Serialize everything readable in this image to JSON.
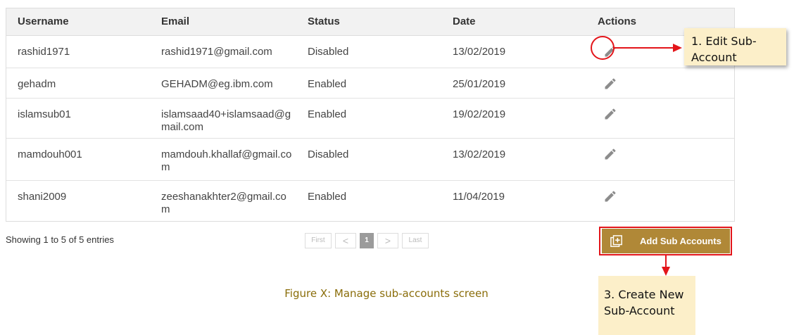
{
  "table": {
    "headers": [
      "Username",
      "Email",
      "Status",
      "Date",
      "Actions"
    ],
    "rows": [
      {
        "username": "rashid1971",
        "email": "rashid1971@gmail.com",
        "status": "Disabled",
        "date": "13/02/2019"
      },
      {
        "username": "gehadm",
        "email": "GEHADM@eg.ibm.com",
        "status": "Enabled",
        "date": "25/01/2019"
      },
      {
        "username": "islamsub01",
        "email": "islamsaad40+islamsaad@gmail.com",
        "status": "Enabled",
        "date": "19/02/2019"
      },
      {
        "username": "mamdouh001",
        "email": "mamdouh.khallaf@gmail.com",
        "status": "Disabled",
        "date": "13/02/2019"
      },
      {
        "username": "shani2009",
        "email": "zeeshanakhter2@gmail.com",
        "status": "Enabled",
        "date": "11/04/2019"
      }
    ],
    "action_icon": "pencil-icon"
  },
  "footer": {
    "showing": "Showing 1 to 5 of 5 entries",
    "pager": {
      "first": "First",
      "prev": "<",
      "current": "1",
      "next": ">",
      "last": "Last"
    }
  },
  "add_button": {
    "label": "Add Sub Accounts",
    "icon": "add-box-icon"
  },
  "annotations": {
    "edit_callout": "1. Edit Sub-Account",
    "create_callout": "3. Create New Sub-Account"
  },
  "caption": "Figure X: Manage sub-accounts screen",
  "colors": {
    "accent": "#b08837",
    "highlight": "#e3151a",
    "callout_bg": "#fcefc9",
    "caption": "#8a6d0a"
  }
}
